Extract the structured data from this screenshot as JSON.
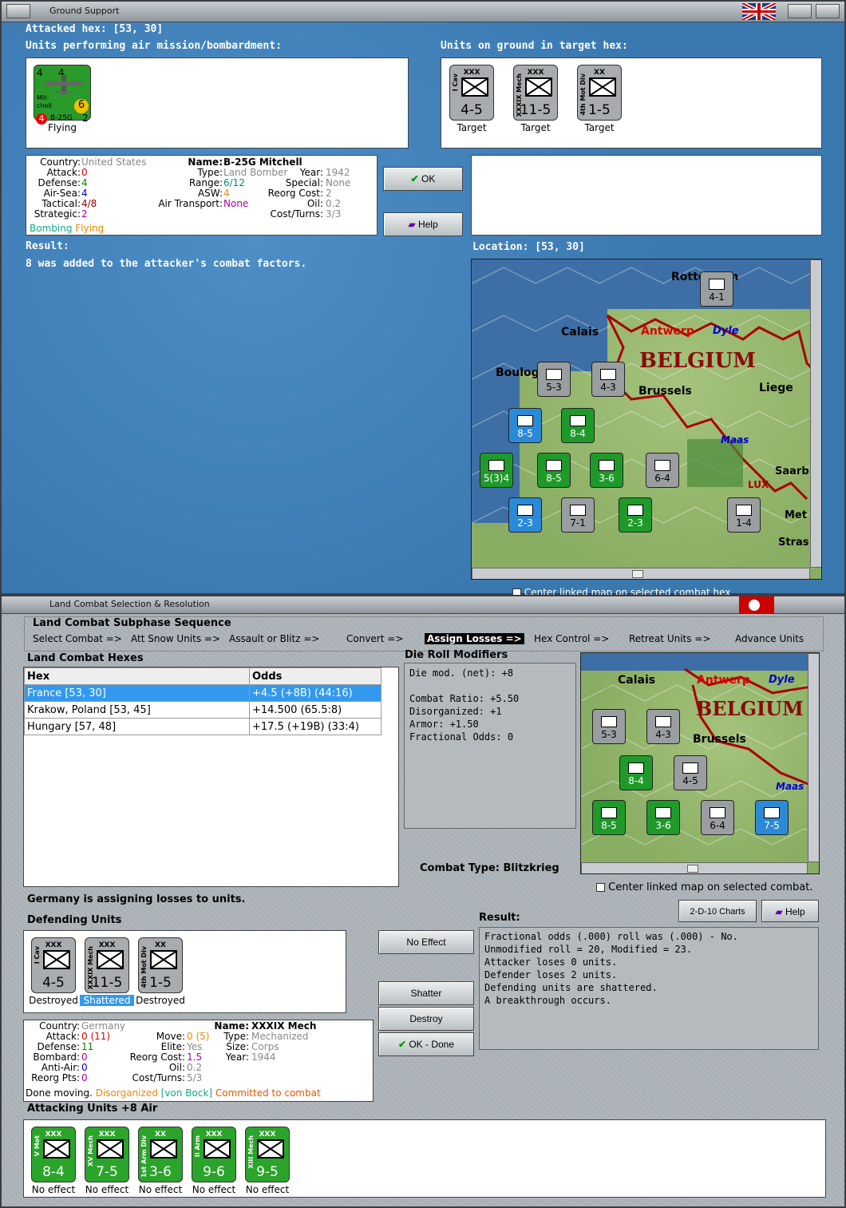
{
  "top_window": {
    "title": "Ground Support",
    "attacked_hex": "Attacked hex:  [53, 30]",
    "air_units_header": "Units performing air mission/bombardment:",
    "ground_units_header": "Units on ground in target hex:",
    "air_unit": {
      "name_line1": "Mit-",
      "name_line2": "chell",
      "model": "B-25G",
      "n_tl": "4",
      "n_tr": "4",
      "n_br": "2",
      "n_bl": "4",
      "range": "6",
      "caption": "Flying"
    },
    "ground_units": [
      {
        "corps": "XXX",
        "side": "I Cav",
        "strength": "4-5",
        "caption": "Target"
      },
      {
        "corps": "XXX",
        "side": "XXXIX Mech",
        "strength": "11-5",
        "caption": "Target"
      },
      {
        "corps": "XX",
        "side": "4th Mot Div",
        "strength": "1-5",
        "caption": "Target"
      }
    ],
    "info": {
      "country_label": "Country:",
      "country": "United States",
      "attack_label": "Attack:",
      "attack": "0",
      "defense_label": "Defense:",
      "defense": "4",
      "airsea_label": "Air-Sea:",
      "airsea": "4",
      "tactical_label": "Tactical:",
      "tactical": "4/8",
      "strategic_label": "Strategic:",
      "strategic": "2",
      "bombing": "Bombing",
      "flying": "Flying",
      "name_label": "Name:",
      "name": "B-25G Mitchell",
      "type_label": "Type:",
      "type": "Land Bomber",
      "year_label": "Year:",
      "year": "1942",
      "range_label": "Range:",
      "range": "6/12",
      "special_label": "Special:",
      "special": "None",
      "asw_label": "ASW:",
      "asw": "4",
      "reorg_label": "Reorg Cost:",
      "reorg": "2",
      "airtrans_label": "Air Transport:",
      "airtrans": "None",
      "oil_label": "Oil:",
      "oil": "0.2",
      "cost_label": "Cost/Turns:",
      "cost": "3/3"
    },
    "ok_label": "OK",
    "help_label": "Help",
    "result_header": "Result:",
    "result_text": "8 was added to the attacker's combat factors.",
    "location_header": "Location:  [53, 30]",
    "center_linked_label": "Center linked map on selected combat hex",
    "map_labels": {
      "rotterdam": "Rotterdam",
      "antwerp": "Antwerp",
      "dyle": "Dyle",
      "calais": "Calais",
      "belgium": "BELGIUM",
      "boulogne": "Boulog",
      "brussels": "Brussels",
      "liege": "Liege",
      "maas": "Maas",
      "saar": "Saarb",
      "lux": "LUX.",
      "metz": "Met",
      "strasb": "Stras"
    },
    "map_strengths": [
      "4-1",
      "5-3",
      "4-3",
      "8-5",
      "8-4",
      "5(3)4",
      "8-5",
      "3-6",
      "6-4",
      "2-3",
      "7-1",
      "2-3",
      "1-4"
    ]
  },
  "bottom_window": {
    "title": "Land Combat Selection & Resolution",
    "sequence_header": "Land Combat Subphase Sequence",
    "sequence": [
      "Select Combat =>",
      "Att Snow Units =>",
      "Assault or Blitz =>",
      "Convert =>",
      "Assign Losses =>",
      "Hex Control =>",
      "Retreat Units =>",
      "Advance Units"
    ],
    "hexes_header": "Land Combat Hexes",
    "table_headers": [
      "Hex",
      "Odds"
    ],
    "table_rows": [
      {
        "hex": "France [53, 30]",
        "odds": "+4.5 (+8B) (44:16)"
      },
      {
        "hex": "Krakow, Poland [53, 45]",
        "odds": "+14.500 (65.5:8)"
      },
      {
        "hex": "Hungary [57, 48]",
        "odds": "+17.5 (+19B) (33:4)"
      }
    ],
    "die_header": "Die Roll Modifiers",
    "die_lines": [
      "Die mod. (net): +8",
      "",
      "Combat Ratio: +5.50",
      "Disorganized: +1",
      "Armor: +1.50",
      "Fractional Odds: 0"
    ],
    "combat_type_label": "Combat Type:",
    "combat_type": "Blitzkrieg",
    "center_combat_label": "Center linked map on selected combat.",
    "assign_text": "Germany is assigning losses to units.",
    "charts_label": "2-D-10 Charts",
    "help_label": "Help",
    "defending_header": "Defending Units",
    "defenders": [
      {
        "corps": "XXX",
        "side": "I Cav",
        "strength": "4-5",
        "caption": "Destroyed"
      },
      {
        "corps": "XXX",
        "side": "XXXIX Mech",
        "strength": "11-5",
        "caption": "Shattered"
      },
      {
        "corps": "XX",
        "side": "4th Mot Div",
        "strength": "1-5",
        "caption": "Destroyed"
      }
    ],
    "no_effect_label": "No Effect",
    "shatter_label": "Shatter",
    "destroy_label": "Destroy",
    "okdone_label": "OK - Done",
    "result_header": "Result:",
    "result_lines": [
      "Fractional odds (.000) roll was (.000)  - No.",
      "Unmodified roll = 20, Modified = 23.",
      "Attacker loses 0 units.",
      "Defender loses 2 units.",
      "Defending units are shattered.",
      "A breakthrough occurs."
    ],
    "info": {
      "country_label": "Country:",
      "country": "Germany",
      "attack_label": "Attack:",
      "attack": "0 (11)",
      "defense_label": "Defense:",
      "defense": "11",
      "bombard_label": "Bombard:",
      "bombard": "0",
      "antiair_label": "Anti-Air:",
      "antiair": "0",
      "reorgpts_label": "Reorg Pts:",
      "reorgpts": "0",
      "move_label": "Move:",
      "move": "0 (5)",
      "elite_label": "Elite:",
      "elite": "Yes",
      "reorgcost_label": "Reorg Cost:",
      "reorgcost": "1.5",
      "oil_label": "Oil:",
      "oil": "0.2",
      "cost_label": "Cost/Turns:",
      "cost": "5/3",
      "name_label": "Name:",
      "name": "XXXIX Mech",
      "type_label": "Type:",
      "type": "Mechanized",
      "size_label": "Size:",
      "size": "Corps",
      "year_label": "Year:",
      "year": "1944",
      "status_done": "Done moving.",
      "status_disorg": "Disorganized",
      "status_leader": "[von Bock]",
      "status_committed": "Committed to combat"
    },
    "attacking_header": "Attacking Units +8 Air",
    "attackers": [
      {
        "corps": "XXX",
        "side": "V Mot",
        "strength": "8-4",
        "caption": "No effect"
      },
      {
        "corps": "XXX",
        "side": "XV Mech",
        "strength": "7-5",
        "caption": "No effect"
      },
      {
        "corps": "XX",
        "side": "1st Arm Div",
        "strength": "3-6",
        "caption": "No effect"
      },
      {
        "corps": "XXX",
        "side": "II Arm",
        "strength": "9-6",
        "caption": "No effect"
      },
      {
        "corps": "XXX",
        "side": "XIII Mech",
        "strength": "9-5",
        "caption": "No effect"
      }
    ],
    "map_labels": {
      "calais": "Calais",
      "antwerp": "Antwerp",
      "dyle": "Dyle",
      "belgium": "BELGIUM",
      "brussels": "Brussels",
      "maas": "Maas"
    },
    "map_strengths": [
      "5-3",
      "4-3",
      "8-4",
      "4-5",
      "8-5",
      "3-6",
      "6-4",
      "7-5"
    ]
  }
}
